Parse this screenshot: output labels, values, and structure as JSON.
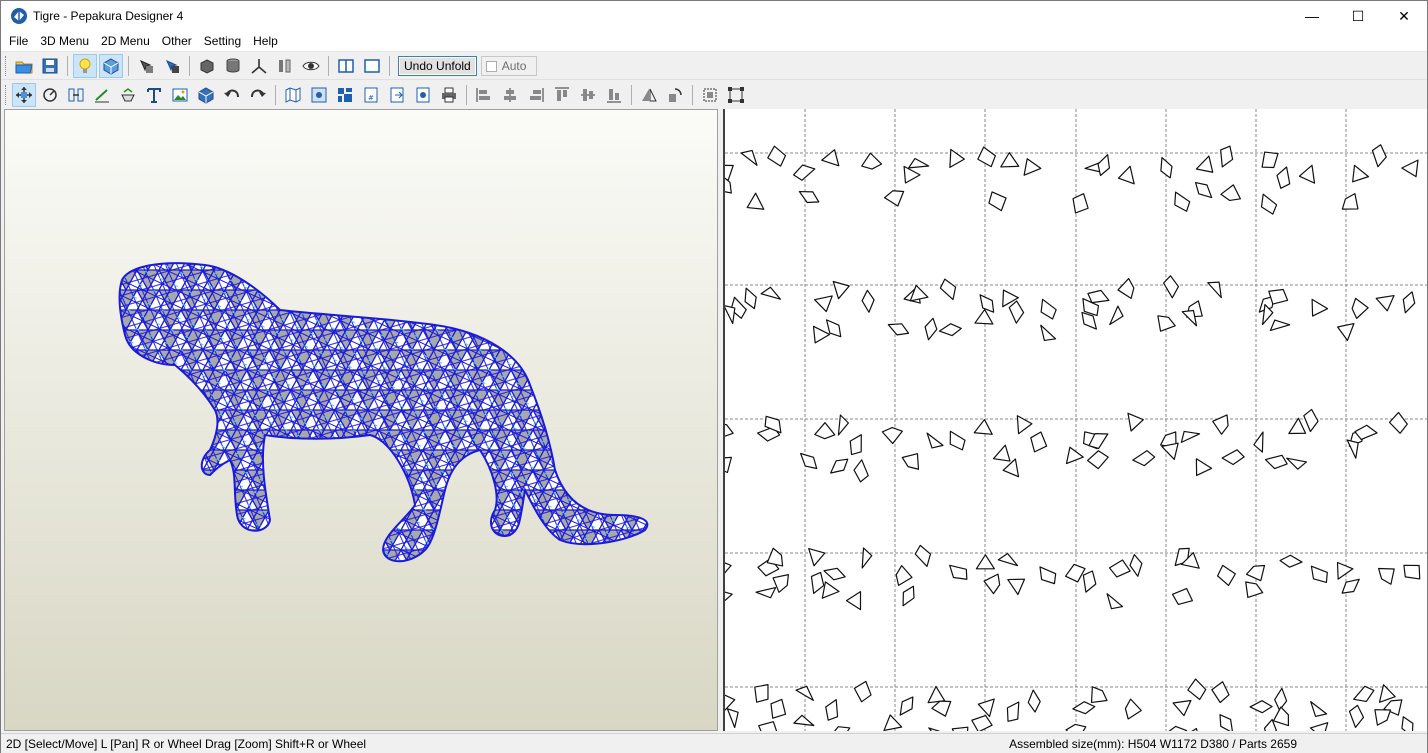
{
  "window": {
    "title": "Tigre - Pepakura Designer 4",
    "controls": {
      "minimize": "—",
      "maximize": "☐",
      "close": "✕"
    }
  },
  "menu": [
    "File",
    "3D Menu",
    "2D Menu",
    "Other",
    "Setting",
    "Help"
  ],
  "toolbar": {
    "undo_unfold_label": "Undo Unfold",
    "auto_label": "Auto",
    "auto_checked": false
  },
  "status": {
    "left": "2D [Select/Move] L [Pan] R or Wheel Drag [Zoom] Shift+R or Wheel",
    "right": "Assembled size(mm): H504 W1172 D380 / Parts 2659"
  },
  "colors": {
    "mesh_edge": "#1a1adb",
    "mesh_fill": "#a8a8a8",
    "mesh_highlight": "#3fd1e6",
    "view3d_top": "#fbfbf8",
    "view3d_bottom": "#d8d7c4",
    "page_dash": "#8a8a8a"
  },
  "icons": {
    "toolbar1": [
      "open-folder-icon",
      "save-icon",
      "light-bulb-icon",
      "texture-cube-icon",
      "select-part-icon",
      "select-face-icon",
      "solid-box-icon",
      "cylinder-icon",
      "axis-icon",
      "flaps-icon",
      "eye-icon",
      "split-view-icon",
      "single-view-icon"
    ],
    "toolbar2": [
      "select-move-icon",
      "rotate-icon",
      "join-edge-icon",
      "edge-line-icon",
      "flap-icon",
      "text-icon",
      "image-icon",
      "box3d-icon",
      "undo-icon",
      "redo-icon",
      "map-icon",
      "zoom-fit-icon",
      "layout-icon",
      "page-number-icon",
      "export-icon",
      "print-preview-icon",
      "print-icon",
      "align-left-icon",
      "align-center-icon",
      "align-right-icon",
      "align-top-icon",
      "align-middle-icon",
      "align-bottom-icon",
      "flip-icon",
      "rotate-part-icon",
      "fit-page-icon",
      "group-icon"
    ]
  }
}
